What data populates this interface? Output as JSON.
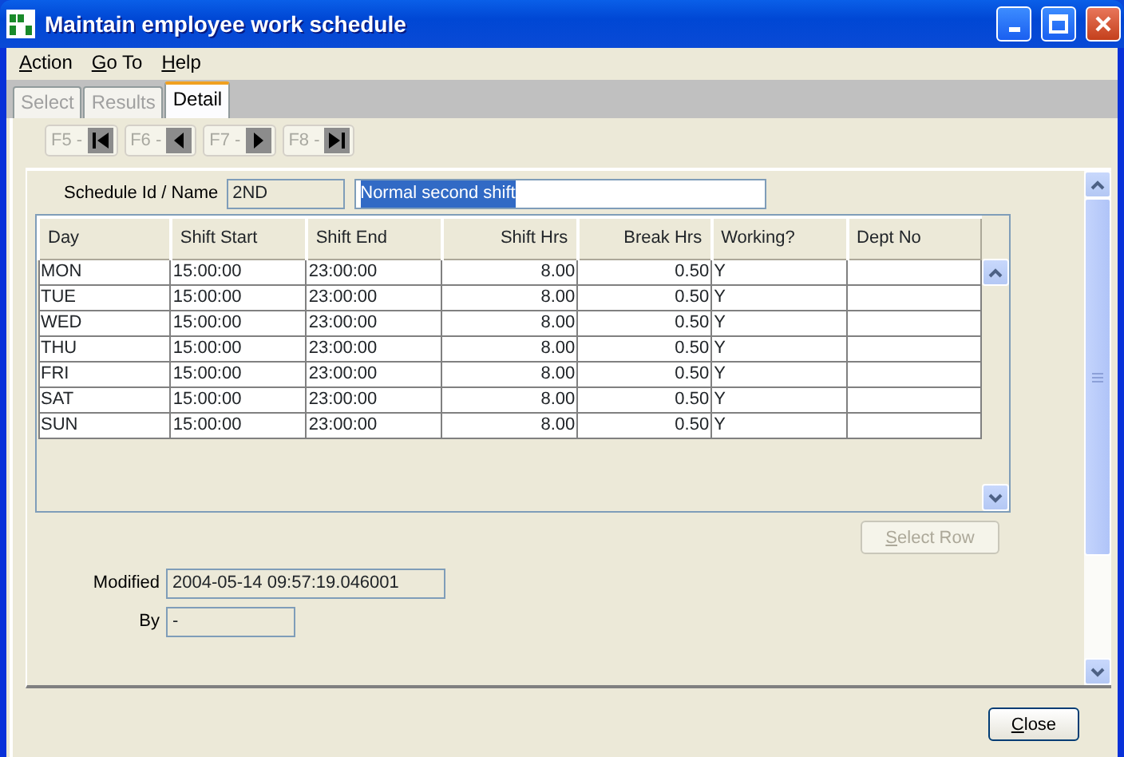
{
  "window": {
    "title": "Maintain employee work schedule"
  },
  "menu": [
    {
      "label": "Action"
    },
    {
      "label": "Go To"
    },
    {
      "label": "Help"
    }
  ],
  "tabs": [
    {
      "label": "Select",
      "selected": false
    },
    {
      "label": "Results",
      "selected": false
    },
    {
      "label": "Detail",
      "selected": true
    }
  ],
  "nav_buttons": [
    {
      "label": "F5 -",
      "kind": "first",
      "disabled": true
    },
    {
      "label": "F6 -",
      "kind": "prev",
      "disabled": true
    },
    {
      "label": "F7 -",
      "kind": "next",
      "disabled": true
    },
    {
      "label": "F8 -",
      "kind": "last",
      "disabled": true
    }
  ],
  "schedule": {
    "label": "Schedule Id / Name",
    "id": "2ND",
    "name": "Normal second shift",
    "name_text_selected": true
  },
  "table": {
    "columns": [
      {
        "label": "Day",
        "kind": "text"
      },
      {
        "label": "Shift Start",
        "kind": "text"
      },
      {
        "label": "Shift End",
        "kind": "text"
      },
      {
        "label": "Shift Hrs",
        "kind": "number"
      },
      {
        "label": "Break Hrs",
        "kind": "number"
      },
      {
        "label": "Working?",
        "kind": "text"
      },
      {
        "label": "Dept No",
        "kind": "text"
      }
    ],
    "rows": [
      [
        "MON",
        "15:00:00",
        "23:00:00",
        "8.00",
        "0.50",
        "Y",
        ""
      ],
      [
        "TUE",
        "15:00:00",
        "23:00:00",
        "8.00",
        "0.50",
        "Y",
        ""
      ],
      [
        "WED",
        "15:00:00",
        "23:00:00",
        "8.00",
        "0.50",
        "Y",
        ""
      ],
      [
        "THU",
        "15:00:00",
        "23:00:00",
        "8.00",
        "0.50",
        "Y",
        ""
      ],
      [
        "FRI",
        "15:00:00",
        "23:00:00",
        "8.00",
        "0.50",
        "Y",
        ""
      ],
      [
        "SAT",
        "15:00:00",
        "23:00:00",
        "8.00",
        "0.50",
        "Y",
        ""
      ],
      [
        "SUN",
        "15:00:00",
        "23:00:00",
        "8.00",
        "0.50",
        "Y",
        ""
      ]
    ]
  },
  "select_row_button": {
    "label": "Select Row",
    "disabled": true
  },
  "modified": {
    "label": "Modified",
    "value": "2004-05-14 09:57:19.046001"
  },
  "by": {
    "label": "By",
    "value": "-"
  },
  "buttons": [
    {
      "label": "Close"
    }
  ]
}
